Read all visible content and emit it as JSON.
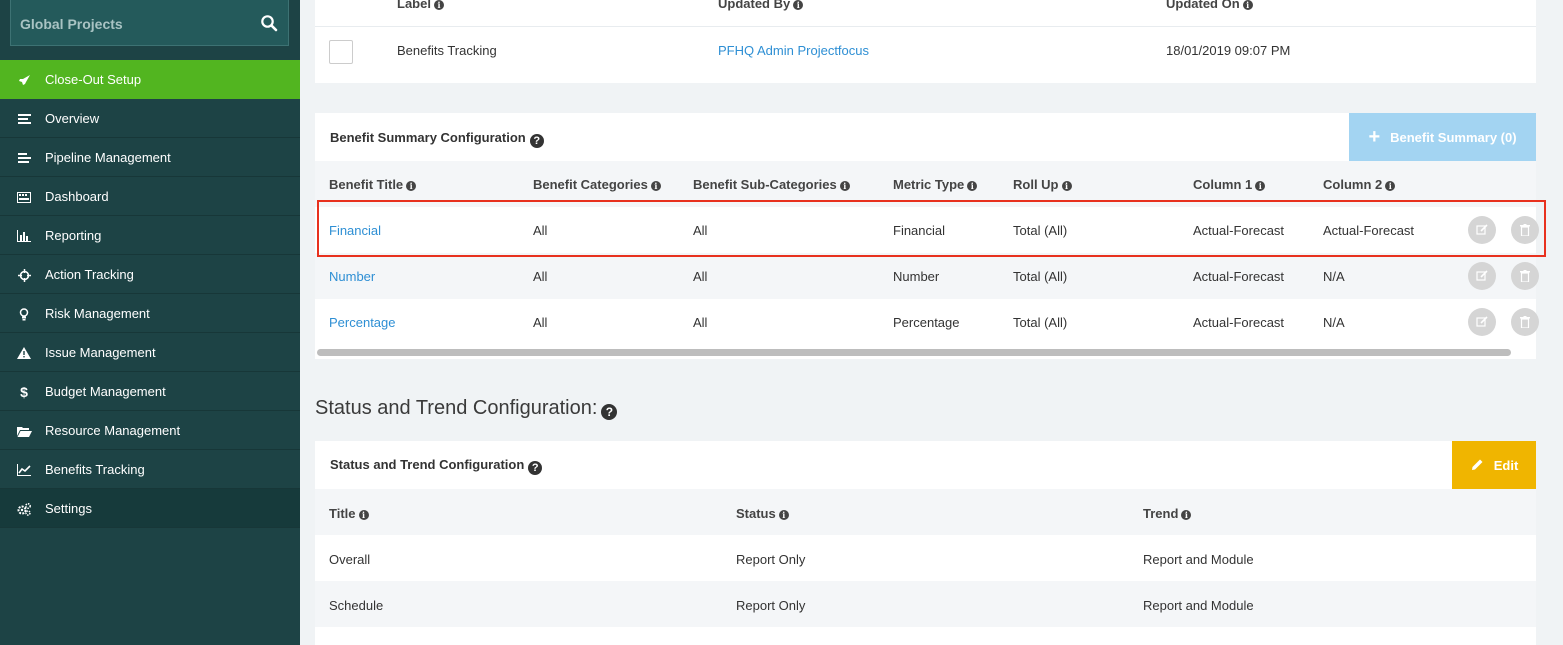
{
  "sidebar": {
    "search_placeholder": "Global Projects",
    "items": [
      {
        "label": "Close-Out Setup",
        "icon": "rocket-icon"
      },
      {
        "label": "Overview",
        "icon": "list-icon"
      },
      {
        "label": "Pipeline Management",
        "icon": "list-lines-icon"
      },
      {
        "label": "Dashboard",
        "icon": "keyboard-icon"
      },
      {
        "label": "Reporting",
        "icon": "bar-chart-icon"
      },
      {
        "label": "Action Tracking",
        "icon": "crosshair-icon"
      },
      {
        "label": "Risk Management",
        "icon": "lightbulb-icon"
      },
      {
        "label": "Issue Management",
        "icon": "warning-icon"
      },
      {
        "label": "Budget Management",
        "icon": "dollar-icon"
      },
      {
        "label": "Resource Management",
        "icon": "folder-open-icon"
      },
      {
        "label": "Benefits Tracking",
        "icon": "line-chart-icon"
      },
      {
        "label": "Settings",
        "icon": "gears-icon"
      }
    ]
  },
  "top_table": {
    "headers": [
      "Label",
      "Updated By",
      "Updated On"
    ],
    "row": {
      "label": "Benefits Tracking",
      "updated_by": "PFHQ Admin Projectfocus",
      "updated_on": "18/01/2019 09:07 PM"
    }
  },
  "benefit_summary": {
    "title": "Benefit Summary Configuration",
    "button_label": "Benefit Summary (0)",
    "headers": [
      "Benefit Title",
      "Benefit Categories",
      "Benefit Sub-Categories",
      "Metric Type",
      "Roll Up",
      "Column 1",
      "Column 2"
    ],
    "rows": [
      [
        "Financial",
        "All",
        "All",
        "Financial",
        "Total (All)",
        "Actual-Forecast",
        "Actual-Forecast"
      ],
      [
        "Number",
        "All",
        "All",
        "Number",
        "Total (All)",
        "Actual-Forecast",
        "N/A"
      ],
      [
        "Percentage",
        "All",
        "All",
        "Percentage",
        "Total (All)",
        "Actual-Forecast",
        "N/A"
      ]
    ]
  },
  "status_trend": {
    "section_heading": "Status and Trend Configuration:",
    "panel_title": "Status and Trend Configuration",
    "edit_label": "Edit",
    "headers": [
      "Title",
      "Status",
      "Trend"
    ],
    "rows": [
      [
        "Overall",
        "Report Only",
        "Report and Module"
      ],
      [
        "Schedule",
        "Report Only",
        "Report and Module"
      ]
    ]
  }
}
